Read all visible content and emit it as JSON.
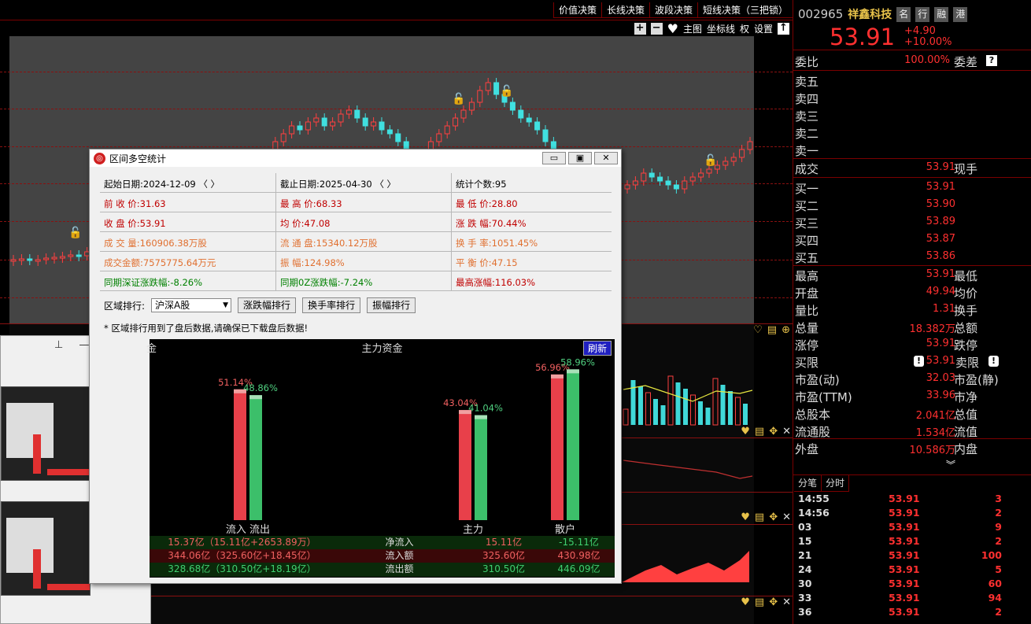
{
  "top_buttons": [
    "价值决策",
    "长线决策",
    "波段决策",
    "短线决策（三把锁）"
  ],
  "toolbar2": {
    "plus": "+",
    "minus": "−",
    "heart": "♥",
    "main_chart": "主图",
    "axis": "坐标线",
    "rights": "权",
    "settings": "设置",
    "up": "↑"
  },
  "dialog": {
    "title": "区间多空统计",
    "stats": [
      [
        {
          "t": "起始日期:2024-12-09   〈 〉",
          "c": "black"
        },
        {
          "t": "截止日期:2025-04-30     〈 〉",
          "c": "black"
        },
        {
          "t": "统计个数:95",
          "c": "black"
        }
      ],
      [
        {
          "t": "前 收 价:31.63",
          "c": "red"
        },
        {
          "t": "最 高 价:68.33",
          "c": "red"
        },
        {
          "t": "最 低 价:28.80",
          "c": "red"
        }
      ],
      [
        {
          "t": "收 盘 价:53.91",
          "c": "red"
        },
        {
          "t": "均     价:47.08",
          "c": "red"
        },
        {
          "t": "涨 跌 幅:70.44%",
          "c": "red"
        }
      ],
      [
        {
          "t": "成 交 量:160906.38万股",
          "c": "orange"
        },
        {
          "t": "流 通 盘:15340.12万股",
          "c": "orange"
        },
        {
          "t": "换 手 率:1051.45%",
          "c": "orange"
        }
      ],
      [
        {
          "t": "成交金额:7575775.64万元",
          "c": "orange"
        },
        {
          "t": "振     幅:124.98%",
          "c": "orange"
        },
        {
          "t": "平 衡 价:47.15",
          "c": "orange"
        }
      ],
      [
        {
          "t": "同期深证涨跌幅:-8.26%",
          "c": "green"
        },
        {
          "t": "同期0Z涨跌幅:-7.24%",
          "c": "green"
        },
        {
          "t": "最高涨幅:116.03%",
          "c": "red"
        }
      ]
    ],
    "rank_label": "区域排行:",
    "rank_select": "沪深A股",
    "rank_buttons": [
      "涨跌幅排行",
      "换手率排行",
      "振幅排行"
    ],
    "note": "* 区域排行用到了盘后数据,请确保已下载盘后数据!"
  },
  "fund": {
    "title": "主力资金",
    "left_label": "金",
    "refresh": "刷新",
    "chart_data": {
      "type": "bar",
      "categories": [
        "流入 流出",
        "主力",
        "散户"
      ],
      "series": [
        {
          "values": [
            51.14,
            43.04,
            56.96
          ]
        },
        {
          "values": [
            48.86,
            41.04,
            58.96
          ]
        }
      ],
      "labels": [
        [
          "51.14%",
          "48.86%"
        ],
        [
          "43.04%",
          "41.04%"
        ],
        [
          "56.96%",
          "58.96%"
        ]
      ],
      "ylim": [
        0,
        60
      ]
    },
    "cat_labels": [
      "流入 流出",
      "主力",
      "散户"
    ],
    "rows": [
      {
        "a": "15.37亿（15.11亿+2653.89万）",
        "b": "净流入",
        "c": "15.11亿",
        "d": "-15.11亿"
      },
      {
        "a": "344.06亿（325.60亿+18.45亿）",
        "b": "流入额",
        "c": "325.60亿",
        "d": "430.98亿"
      },
      {
        "a": "328.68亿（310.50亿+18.19亿）",
        "b": "流出额",
        "c": "310.50亿",
        "d": "446.09亿"
      }
    ]
  },
  "right": {
    "code": "002965",
    "name": "祥鑫科技",
    "tabs": [
      "名",
      "行",
      "融",
      "港"
    ],
    "price": "53.91",
    "change": "+4.90",
    "change_pct": "+10.00%",
    "webi": {
      "label": "委比",
      "value": "100.00%",
      "label2": "委差"
    },
    "sells": [
      "卖五",
      "卖四",
      "卖三",
      "卖二",
      "卖一"
    ],
    "deal": {
      "label": "成交",
      "value": "53.91",
      "label2": "现手"
    },
    "buys": [
      {
        "label": "买一",
        "value": "53.91"
      },
      {
        "label": "买二",
        "value": "53.90"
      },
      {
        "label": "买三",
        "value": "53.89"
      },
      {
        "label": "买四",
        "value": "53.87"
      },
      {
        "label": "买五",
        "value": "53.86"
      }
    ],
    "stats": [
      {
        "label": "最高",
        "value": "53.91",
        "label2": "最低"
      },
      {
        "label": "开盘",
        "value": "49.94",
        "label2": "均价"
      },
      {
        "label": "量比",
        "value": "1.31",
        "label2": "换手"
      },
      {
        "label": "总量",
        "value": "18.382万",
        "label2": "总额"
      },
      {
        "label": "涨停",
        "value": "53.91",
        "label2": "跌停"
      },
      {
        "label": "买限",
        "value": "53.91",
        "label2": "卖限"
      },
      {
        "label": "市盈(动)",
        "value": "32.03",
        "label2": "市盈(静)"
      },
      {
        "label": "市盈(TTM)",
        "value": "33.96",
        "label2": "市净"
      },
      {
        "label": "总股本",
        "value": "2.041亿",
        "label2": "总值"
      },
      {
        "label": "流通股",
        "value": "1.534亿",
        "label2": "流值"
      },
      {
        "label": "外盘",
        "value": "10.586万",
        "label2": "内盘"
      }
    ],
    "tick_tabs": [
      "分笔",
      "分时"
    ],
    "ticks": [
      {
        "t": "14:55",
        "p": "53.91",
        "v": "3"
      },
      {
        "t": "14:56",
        "p": "53.91",
        "v": "2"
      },
      {
        "t": "03",
        "p": "53.91",
        "v": "9"
      },
      {
        "t": "15",
        "p": "53.91",
        "v": "2"
      },
      {
        "t": "21",
        "p": "53.91",
        "v": "100"
      },
      {
        "t": "24",
        "p": "53.91",
        "v": "5"
      },
      {
        "t": "30",
        "p": "53.91",
        "v": "60"
      },
      {
        "t": "33",
        "p": "53.91",
        "v": "94"
      },
      {
        "t": "36",
        "p": "53.91",
        "v": "2"
      }
    ]
  }
}
